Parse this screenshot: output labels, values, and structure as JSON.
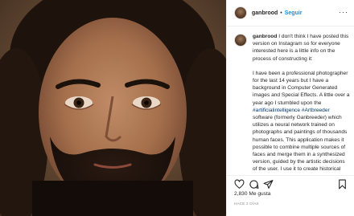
{
  "header": {
    "username": "ganbrood",
    "separator": "•",
    "follow_label": "Seguir",
    "more_label": "···"
  },
  "caption": {
    "username": "ganbrood",
    "intro": " I don't think I have posted this version on Instagram so for everyone interested here is a little info on the process of constructing it:",
    "p2_before_tag1": "I have been a professional photographer for the last 14 years but I have a background in Computer Generated images and Special Effects. A little over a year ago I stumbled upon the ",
    "tag1": "#artificialintelligence",
    "p2_space": " ",
    "tag2": "#Artbreeder",
    "p2_after_tag2": " software (formerly Ganbreeder) which utilizes a neural network trained on photographs and paintings of thousands human faces. This application makes it possible to combine multiple sources of faces and merge them in a synthesized version, guided by the artistic decisions of the user. I use it to create historical and"
  },
  "actions": {
    "icons": [
      "heart-outline-icon",
      "comment-icon",
      "share-icon",
      "bookmark-icon"
    ]
  },
  "likes": "2,830 Me gusta",
  "posted": "HACE 2 DÍAS",
  "colors": {
    "link_blue": "#0095f6",
    "hashtag": "#00376b",
    "muted": "#8e8e8e",
    "border": "#efefef"
  }
}
